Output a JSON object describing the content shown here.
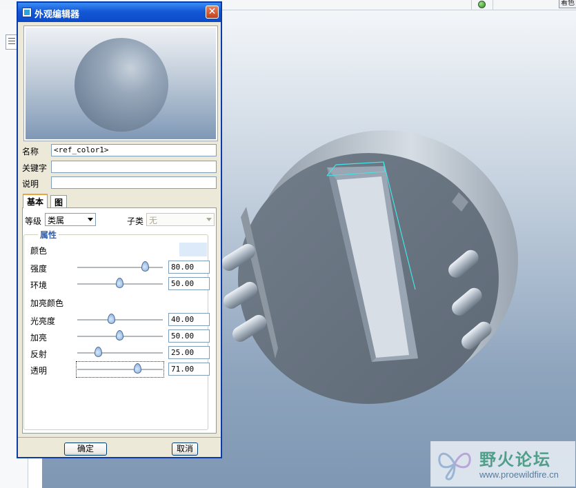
{
  "background": {
    "top_right_button_label": "着色",
    "viewport_label": "3D model viewport"
  },
  "dialog": {
    "title": "外观编辑器",
    "close_label": "✕",
    "fields": {
      "name_label": "名称",
      "name_value": "<ref_color1>",
      "keyword_label": "关键字",
      "keyword_value": "",
      "description_label": "说明",
      "description_value": ""
    },
    "tabs": [
      {
        "label": "基本",
        "active": true
      },
      {
        "label": "图",
        "active": false
      }
    ],
    "class_label": "等级",
    "class_value": "类属",
    "subclass_label": "子类",
    "subclass_value": "无",
    "properties_group": "属性",
    "color_label": "颜色",
    "color_value": "#ddeafa",
    "intensity": {
      "label": "强度",
      "value": "80.00",
      "level": 80
    },
    "ambient": {
      "label": "环境",
      "value": "50.00",
      "level": 50
    },
    "highlight_color_label": "加亮颜色",
    "shininess": {
      "label": "光亮度",
      "value": "40.00",
      "level": 40
    },
    "highlight": {
      "label": "加亮",
      "value": "50.00",
      "level": 50
    },
    "reflection": {
      "label": "反射",
      "value": "25.00",
      "level": 25
    },
    "transparency": {
      "label": "透明",
      "value": "71.00",
      "level": 71
    },
    "ok_label": "确定",
    "cancel_label": "取消"
  },
  "watermark": {
    "title": "野火论坛",
    "url": "www.proewildfire.cn"
  },
  "colors": {
    "titlebar": "#0b4bc9",
    "dialog_bg": "#ece9d8",
    "accent_group_title": "#3161b0",
    "selection_edge": "#45e3e8"
  }
}
